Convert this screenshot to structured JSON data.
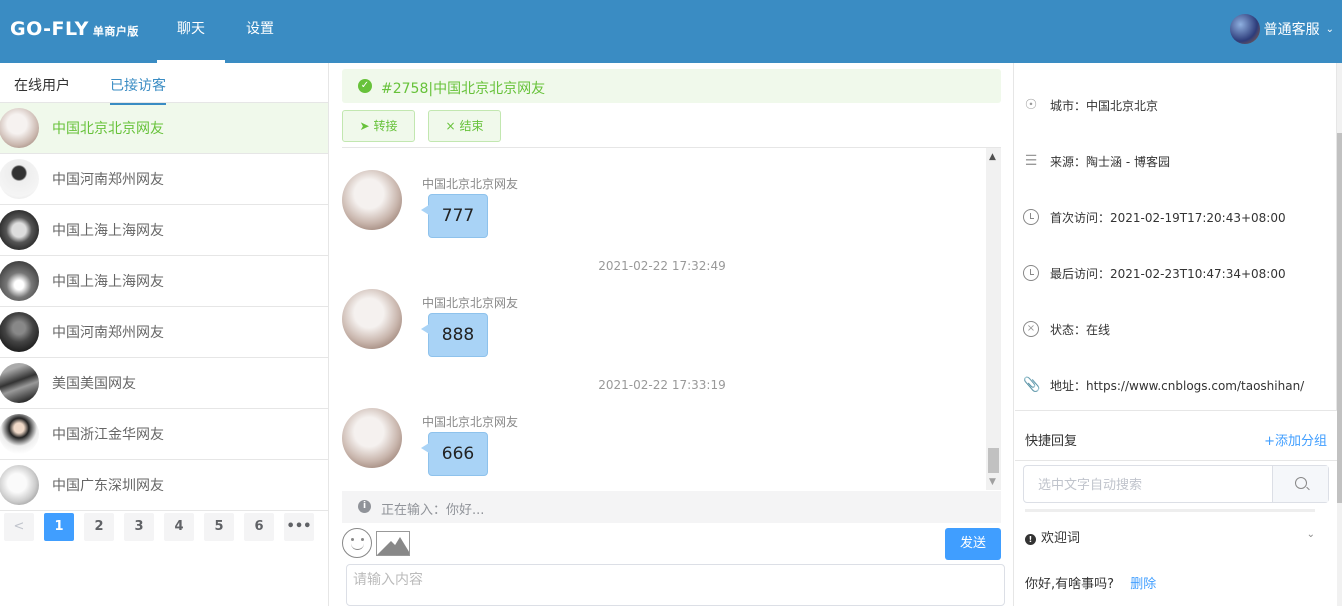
{
  "header": {
    "brand": "GO-FLY",
    "brand_sub": "单商户版",
    "nav": [
      {
        "label": "聊天"
      },
      {
        "label": "设置"
      }
    ],
    "user_name": "普通客服"
  },
  "left": {
    "tabs": [
      {
        "label": "在线用户"
      },
      {
        "label": "已接访客"
      }
    ],
    "visitors": [
      {
        "name": "中国北京北京网友"
      },
      {
        "name": "中国河南郑州网友"
      },
      {
        "name": "中国上海上海网友"
      },
      {
        "name": "中国上海上海网友"
      },
      {
        "name": "中国河南郑州网友"
      },
      {
        "name": "美国美国网友"
      },
      {
        "name": "中国浙江金华网友"
      },
      {
        "name": "中国广东深圳网友"
      }
    ],
    "pager": {
      "pages": [
        "1",
        "2",
        "3",
        "4",
        "5",
        "6"
      ],
      "more": "•••",
      "prev": "<"
    }
  },
  "chat": {
    "title": "#2758|中国北京北京网友",
    "transfer_label": "转接",
    "end_label": "结束",
    "messages": [
      {
        "time": "",
        "name": "中国北京北京网友",
        "text": "777"
      },
      {
        "time": "2021-02-22 17:32:49",
        "name": "中国北京北京网友",
        "text": "888"
      },
      {
        "time": "2021-02-22 17:33:19",
        "name": "中国北京北京网友",
        "text": "666"
      }
    ],
    "typing": "正在输入：你好...",
    "send_label": "发送",
    "input_placeholder": "请输入内容"
  },
  "info": {
    "city": "城市：中国北京北京",
    "source": "来源：陶士涵 - 博客园",
    "first_visit": "首次访问：2021-02-19T17:20:43+08:00",
    "last_visit": "最后访问：2021-02-23T10:47:34+08:00",
    "status": "状态：在线",
    "address": "地址：https://www.cnblogs.com/taoshihan/"
  },
  "quick_reply": {
    "title": "快捷回复",
    "add_group": "+添加分组",
    "search_placeholder": "选中文字自动搜索",
    "group_name": "欢迎词",
    "reply_text": "你好,有啥事吗?",
    "delete_label": "删除"
  },
  "colors": {
    "header": "#3a8cc3",
    "primary": "#409eff",
    "success": "#67c23a",
    "bubble": "#a9d3f6"
  }
}
